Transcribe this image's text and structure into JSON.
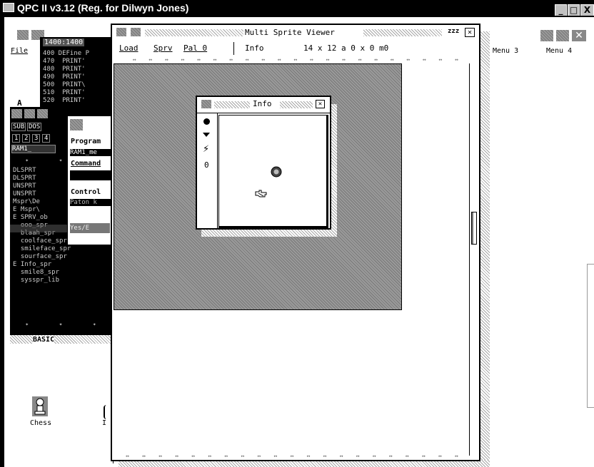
{
  "title_bar": {
    "title": "QPC II v3.12 (Reg. for Dilwyn Jones)",
    "min": "_",
    "max": "□",
    "close": "X"
  },
  "bg_menus": [
    "Menu 3",
    "Menu 4"
  ],
  "editor": {
    "menu_file": "File",
    "line_label": "1400:1400",
    "lines": [
      "400 DEFine P",
      "470  PRINT'",
      "480  PRINT'",
      "490  PRINT'",
      "500  PRINT\\",
      "510  PRINT'",
      "520  PRINT'"
    ],
    "side_letter": "A"
  },
  "jobs": {
    "tabs": [
      "SUB",
      "DOS"
    ],
    "nums": [
      "1",
      "2",
      "3",
      "4"
    ],
    "ram_label": "RAM1_",
    "items": [
      "DLSPRT",
      "DLSPRT",
      "UNSPRT",
      "UNSPRT",
      "Mspr\\De",
      "E Mspr\\",
      "E SPRV_ob",
      "  ooo_spr",
      "  blaah_spr",
      "  coolface_spr",
      "  smileface_spr",
      "  sourface_spr",
      "E Info_spr",
      "  smile8_spr",
      "  sysspr_lib"
    ],
    "footer": "BASIC"
  },
  "dialog": {
    "program_label": "Program",
    "program_value": "RAM1_me",
    "command_label": "Command",
    "control_label": "Control",
    "control_value": "Paton k",
    "button": "Yes/E"
  },
  "desktop_icon": {
    "label": "Chess",
    "partial": "I"
  },
  "viewer": {
    "title": "Multi Sprite Viewer",
    "zzz": "zzz",
    "menu": {
      "load": "Load",
      "sprv": "Sprv",
      "pal": "Pal 0",
      "info": "Info",
      "dims": "14 x 12 a 0 x 0  m0"
    }
  },
  "info_win": {
    "title": "Info",
    "zero": "0"
  }
}
